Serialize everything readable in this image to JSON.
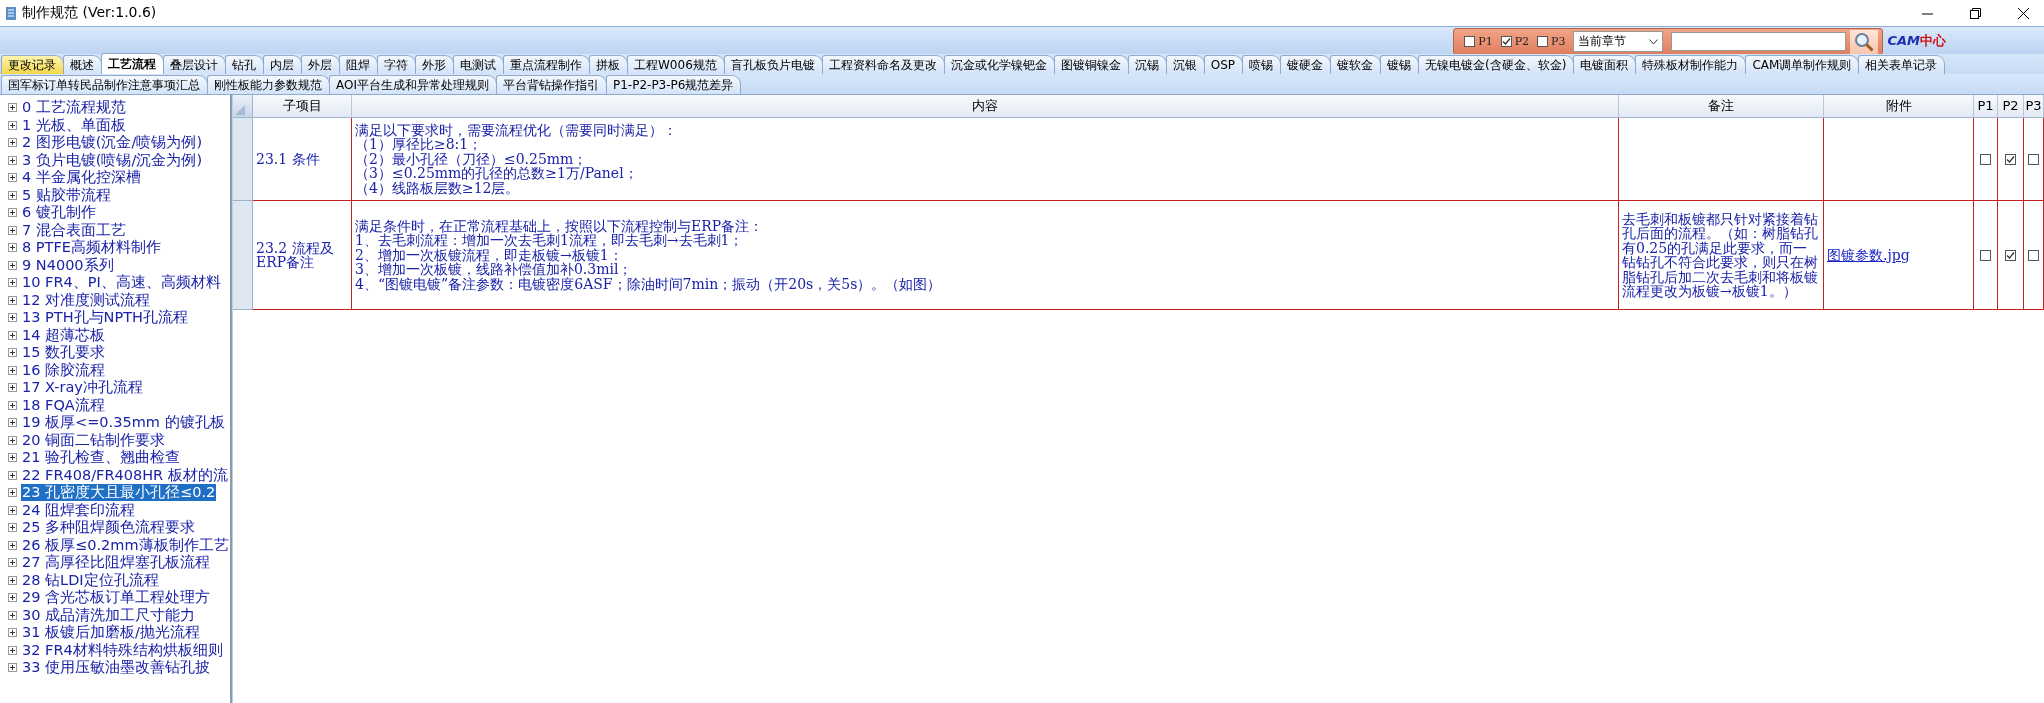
{
  "window": {
    "title": "制作规范 (Ver:1.0.6)"
  },
  "filter": {
    "options": [
      {
        "label": "P1",
        "checked": false
      },
      {
        "label": "P2",
        "checked": true
      },
      {
        "label": "P3",
        "checked": false
      }
    ],
    "scope": "当前章节",
    "logo": {
      "mark": "CAM",
      "text": "中心"
    }
  },
  "tabs_row_1": [
    {
      "label": "更改记录",
      "selected": false,
      "highlighted": true
    },
    {
      "label": "概述",
      "selected": false,
      "highlighted": false
    },
    {
      "label": "工艺流程",
      "selected": true,
      "highlighted": false
    },
    {
      "label": "叠层设计",
      "selected": false,
      "highlighted": false
    },
    {
      "label": "钻孔",
      "selected": false,
      "highlighted": false
    },
    {
      "label": "内层",
      "selected": false,
      "highlighted": false
    },
    {
      "label": "外层",
      "selected": false,
      "highlighted": false
    },
    {
      "label": "阻焊",
      "selected": false,
      "highlighted": false
    },
    {
      "label": "字符",
      "selected": false,
      "highlighted": false
    },
    {
      "label": "外形",
      "selected": false,
      "highlighted": false
    },
    {
      "label": "电测试",
      "selected": false,
      "highlighted": false
    },
    {
      "label": "重点流程制作",
      "selected": false,
      "highlighted": false
    },
    {
      "label": "拼板",
      "selected": false,
      "highlighted": false
    },
    {
      "label": "工程W006规范",
      "selected": false,
      "highlighted": false
    },
    {
      "label": "盲孔板负片电镀",
      "selected": false,
      "highlighted": false
    },
    {
      "label": "工程资料命名及更改",
      "selected": false,
      "highlighted": false
    },
    {
      "label": "沉金或化学镍钯金",
      "selected": false,
      "highlighted": false
    },
    {
      "label": "图镀铜镍金",
      "selected": false,
      "highlighted": false
    },
    {
      "label": "沉锡",
      "selected": false,
      "highlighted": false
    },
    {
      "label": "沉银",
      "selected": false,
      "highlighted": false
    },
    {
      "label": "OSP",
      "selected": false,
      "highlighted": false
    },
    {
      "label": "喷锡",
      "selected": false,
      "highlighted": false
    },
    {
      "label": "镀硬金",
      "selected": false,
      "highlighted": false
    },
    {
      "label": "镀软金",
      "selected": false,
      "highlighted": false
    },
    {
      "label": "镀锡",
      "selected": false,
      "highlighted": false
    },
    {
      "label": "无镍电镀金(含硬金、软金)",
      "selected": false,
      "highlighted": false
    },
    {
      "label": "电镀面积",
      "selected": false,
      "highlighted": false
    },
    {
      "label": "特殊板材制作能力",
      "selected": false,
      "highlighted": false
    },
    {
      "label": "CAM调单制作规则",
      "selected": false,
      "highlighted": false
    },
    {
      "label": "相关表单记录",
      "selected": false,
      "highlighted": false
    }
  ],
  "tabs_row_2": [
    {
      "label": "国军标订单转民品制作注意事项汇总",
      "selected": false
    },
    {
      "label": "刚性板能力参数规范",
      "selected": false
    },
    {
      "label": "AOI平台生成和异常处理规则",
      "selected": false
    },
    {
      "label": "平台背钻操作指引",
      "selected": false
    },
    {
      "label": "P1-P2-P3-P6规范差异",
      "selected": false
    }
  ],
  "tree": {
    "items": [
      {
        "label": "0 工艺流程规范",
        "expanded": false,
        "selected": false
      },
      {
        "label": "1 光板、单面板",
        "expanded": false,
        "selected": false
      },
      {
        "label": "2 图形电镀(沉金/喷锡为例)",
        "expanded": false,
        "selected": false
      },
      {
        "label": "3 负片电镀(喷锡/沉金为例)",
        "expanded": false,
        "selected": false
      },
      {
        "label": "4 半金属化控深槽",
        "expanded": false,
        "selected": false
      },
      {
        "label": "5 贴胶带流程",
        "expanded": false,
        "selected": false
      },
      {
        "label": "6 镀孔制作",
        "expanded": false,
        "selected": false
      },
      {
        "label": "7 混合表面工艺",
        "expanded": false,
        "selected": false
      },
      {
        "label": "8 PTFE高频材料制作",
        "expanded": false,
        "selected": false
      },
      {
        "label": "9 N4000系列",
        "expanded": false,
        "selected": false
      },
      {
        "label": "10 FR4、PI、高速、高频材料",
        "expanded": false,
        "selected": false
      },
      {
        "label": "12 对准度测试流程",
        "expanded": false,
        "selected": false
      },
      {
        "label": "13 PTH孔与NPTH孔流程",
        "expanded": false,
        "selected": false
      },
      {
        "label": "14 超薄芯板",
        "expanded": false,
        "selected": false
      },
      {
        "label": "15 数孔要求",
        "expanded": false,
        "selected": false
      },
      {
        "label": "16 除胶流程",
        "expanded": false,
        "selected": false
      },
      {
        "label": "17 X-ray冲孔流程",
        "expanded": false,
        "selected": false
      },
      {
        "label": "18 FQA流程",
        "expanded": false,
        "selected": false
      },
      {
        "label": "19 板厚<=0.35mm 的镀孔板",
        "expanded": false,
        "selected": false
      },
      {
        "label": "20 铜面二钻制作要求",
        "expanded": false,
        "selected": false
      },
      {
        "label": "21 验孔检查、翘曲检查",
        "expanded": false,
        "selected": false
      },
      {
        "label": "22 FR408/FR408HR 板材的流",
        "expanded": false,
        "selected": false
      },
      {
        "label": "23 孔密度大且最小孔径≤0.2",
        "expanded": false,
        "selected": true
      },
      {
        "label": "24 阻焊套印流程",
        "expanded": false,
        "selected": false
      },
      {
        "label": "25 多种阻焊颜色流程要求",
        "expanded": false,
        "selected": false
      },
      {
        "label": "26 板厚≤0.2mm薄板制作工艺",
        "expanded": false,
        "selected": false
      },
      {
        "label": "27 高厚径比阻焊塞孔板流程",
        "expanded": false,
        "selected": false
      },
      {
        "label": "28 钻LDI定位孔流程",
        "expanded": false,
        "selected": false
      },
      {
        "label": "29 含光芯板订单工程处理方",
        "expanded": false,
        "selected": false
      },
      {
        "label": "30 成品清洗加工尺寸能力",
        "expanded": false,
        "selected": false
      },
      {
        "label": "31 板镀后加磨板/抛光流程",
        "expanded": false,
        "selected": false
      },
      {
        "label": "32 FR4材料特殊结构烘板细则",
        "expanded": false,
        "selected": false
      },
      {
        "label": "33 使用压敏油墨改善钻孔披",
        "expanded": false,
        "selected": false
      }
    ]
  },
  "table": {
    "columns": [
      "子项目",
      "内容",
      "备注",
      "附件",
      "P1",
      "P2",
      "P3"
    ],
    "rows": [
      {
        "sub_item": "23.1 条件",
        "content": [
          "满足以下要求时，需要流程优化（需要同时满足）：",
          "（1）厚径比≥8:1；",
          "（2）最小孔径（刀径）≤0.25mm；",
          "（3）≤0.25mm的孔径的总数≥1万/Panel；",
          "（4）线路板层数≥12层。"
        ],
        "p1": false,
        "p2": true,
        "p3": false
      },
      {
        "sub_item": "23.2 流程及ERP备注",
        "content": [
          "满足条件时，在正常流程基础上，按照以下流程控制与ERP备注：",
          "1、去毛刺流程：增加一次去毛刺1流程，即去毛刺→去毛刺1；",
          "2、增加一次板镀流程，即走板镀→板镀1：",
          "3、增加一次板镀，线路补偿值加补0.3mil；",
          "4、“图镀电镀”备注参数：电镀密度6ASF；除油时间7min；振动（开20s，关5s）。（如图）"
        ],
        "remark": "去毛刺和板镀都只针对紧接着钻孔后面的流程。（如：树脂钻孔有0.25的孔满足此要求，而一钻钻孔不符合此要求，则只在树脂钻孔后加二次去毛刺和将板镀流程更改为板镀→板镀1。）",
        "attachment": "图镀参数.jpg",
        "p1": false,
        "p2": true,
        "p3": false
      }
    ]
  }
}
